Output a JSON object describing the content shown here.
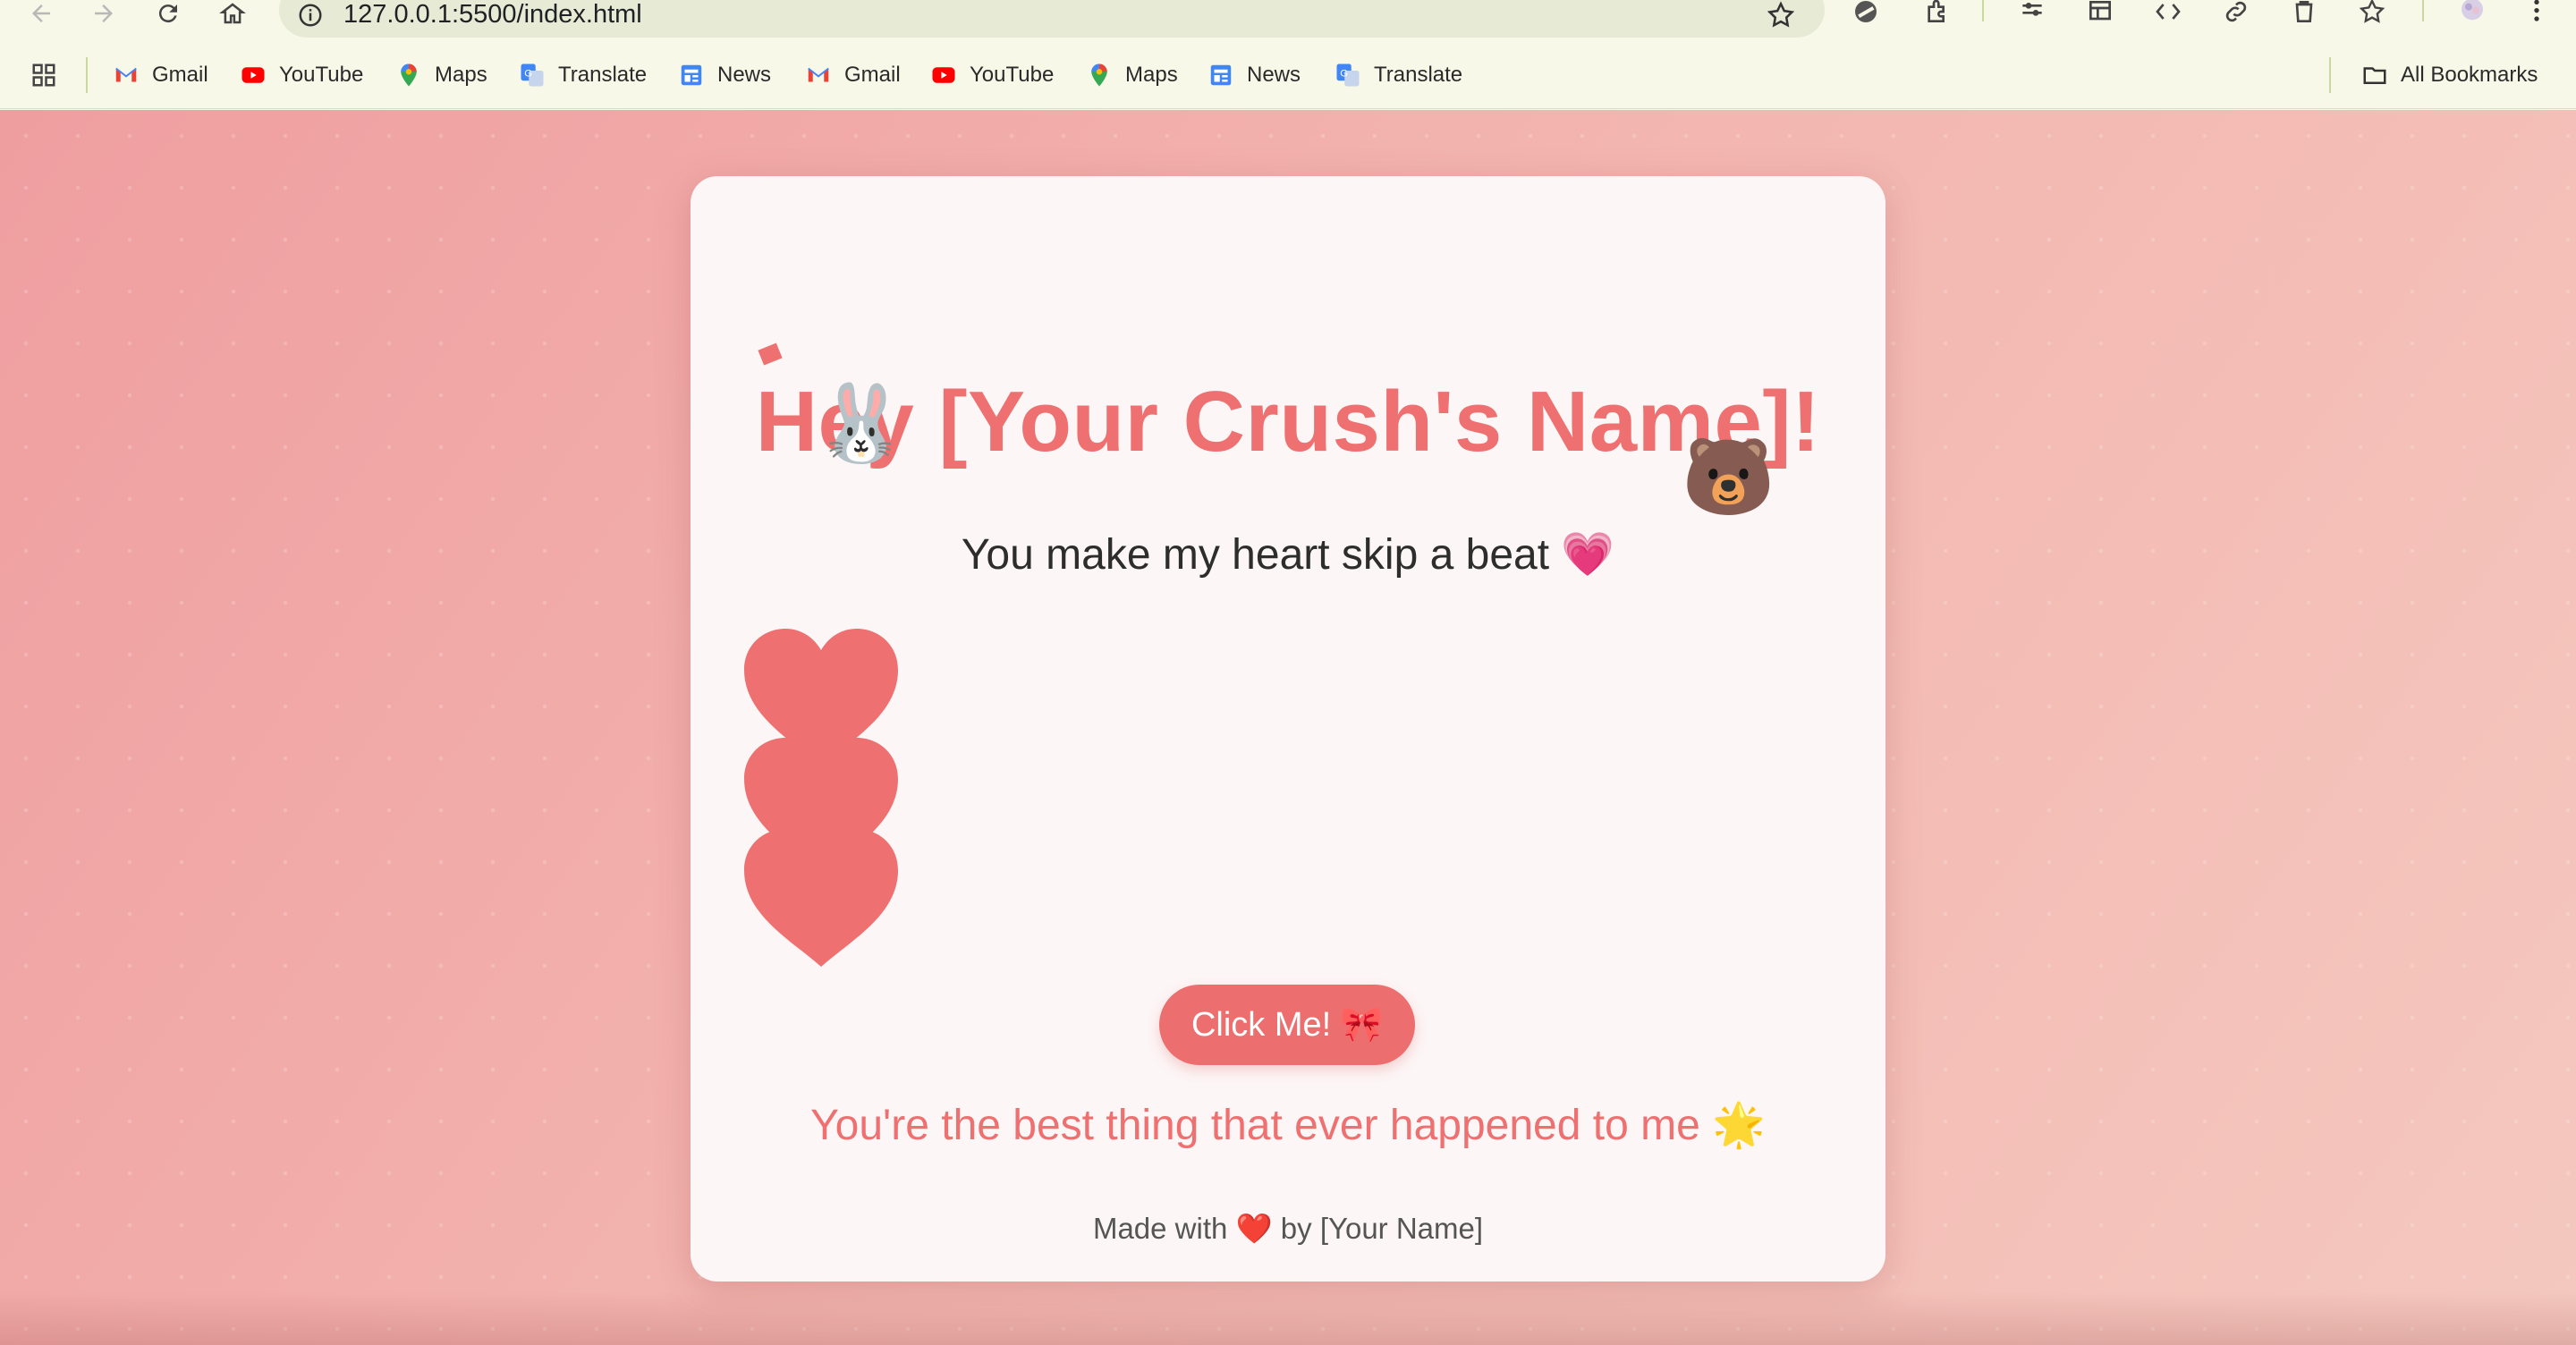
{
  "browser": {
    "url": "127.0.0.1:5500/index.html",
    "bookmarks": [
      {
        "label": "Gmail",
        "icon": "gmail-icon"
      },
      {
        "label": "YouTube",
        "icon": "youtube-icon"
      },
      {
        "label": "Maps",
        "icon": "maps-icon"
      },
      {
        "label": "Translate",
        "icon": "translate-icon"
      },
      {
        "label": "News",
        "icon": "news-icon"
      },
      {
        "label": "Gmail",
        "icon": "gmail-icon"
      },
      {
        "label": "YouTube",
        "icon": "youtube-icon"
      },
      {
        "label": "Maps",
        "icon": "maps-icon"
      },
      {
        "label": "News",
        "icon": "news-icon"
      },
      {
        "label": "Translate",
        "icon": "translate-icon"
      }
    ],
    "all_bookmarks_label": "All Bookmarks"
  },
  "page": {
    "headline": "Hey [Your Crush's Name]!",
    "subtitle": "You make my heart skip a beat 💗",
    "button_label": "Click Me! 🎀",
    "message": "You're the best thing that ever happened to me 🌟",
    "footer": "Made with ❤️ by [Your Name]",
    "bunny_emoji": "🐰",
    "bear_emoji": "🐻",
    "colors": {
      "accent": "#ee7070",
      "button": "#ed6e6e",
      "card": "#fdf6f6",
      "background_start": "#ef9ea0",
      "background_end": "#f4c8bf"
    }
  }
}
